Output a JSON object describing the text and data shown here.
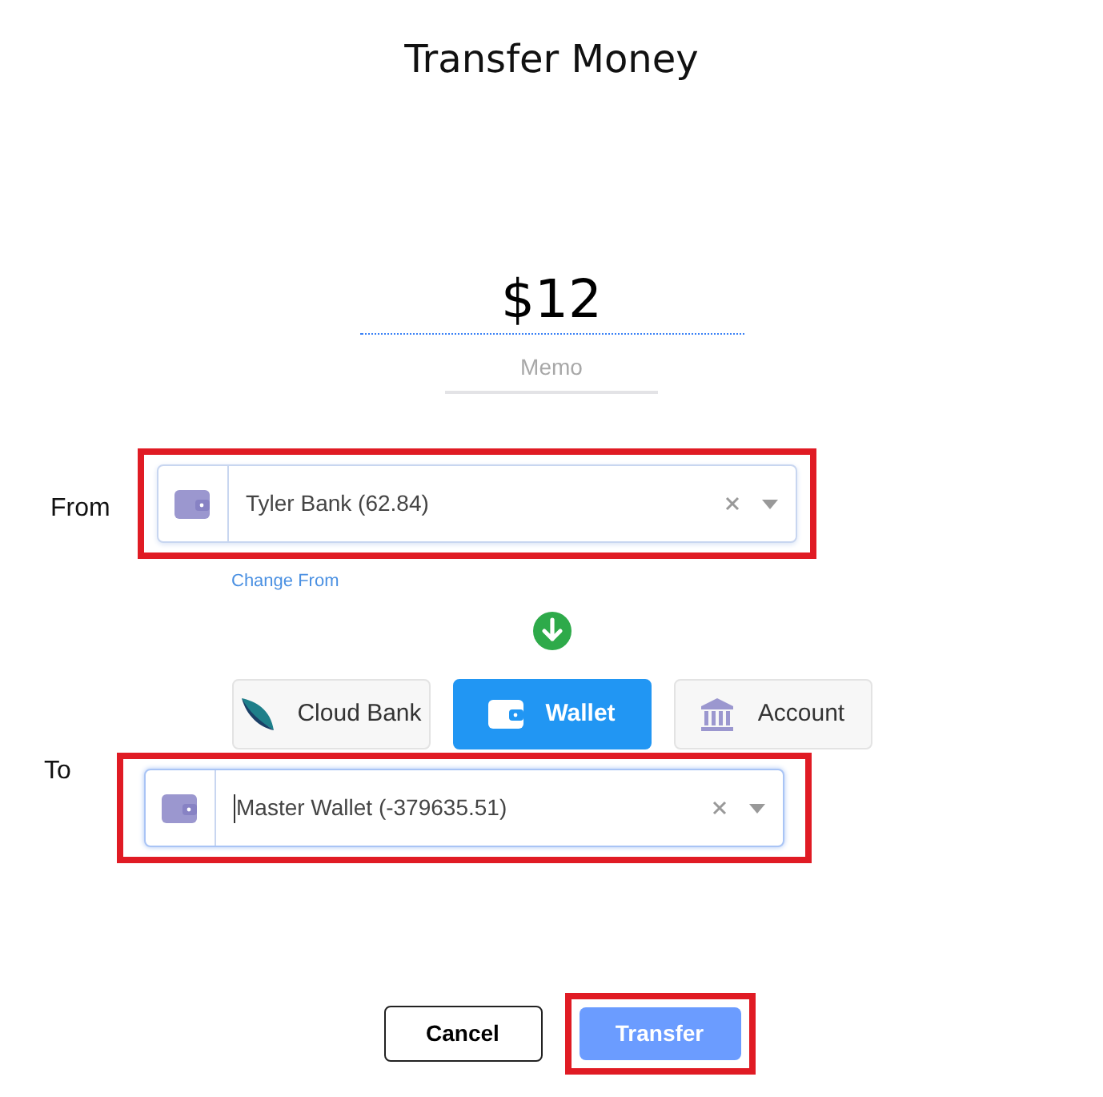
{
  "title": "Transfer Money",
  "amount": "$12",
  "memo": {
    "placeholder": "Memo"
  },
  "from": {
    "label": "From",
    "value": "Tyler Bank (62.84)",
    "highlighted": true,
    "link": "Change From"
  },
  "source_types": [
    {
      "kind": "cloud",
      "label": "Cloud Bank",
      "selected": false
    },
    {
      "kind": "wallet",
      "label": "Wallet",
      "selected": true
    },
    {
      "kind": "bank",
      "label": "Account",
      "selected": false
    }
  ],
  "to": {
    "label": "To",
    "value": "Master Wallet (-379635.51)",
    "highlighted": true,
    "focused": true
  },
  "buttons": [
    {
      "kind": "cancel",
      "label": "Cancel",
      "highlighted": false
    },
    {
      "kind": "primary",
      "label": "Transfer",
      "highlighted": true
    }
  ]
}
